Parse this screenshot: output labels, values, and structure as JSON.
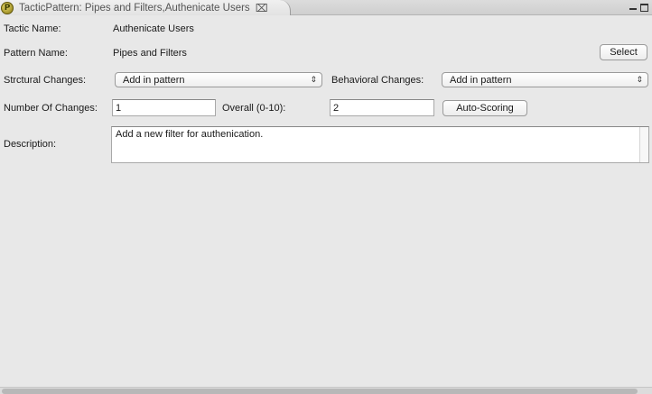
{
  "tab": {
    "title": "TacticPattern: Pipes and Filters,Authenicate Users",
    "icon": "tactic-pattern-icon",
    "icon_glyph": "P",
    "close_glyph": "⌧"
  },
  "form": {
    "tactic_name_label": "Tactic Name:",
    "tactic_name_value": "Authenicate Users",
    "pattern_name_label": "Pattern Name:",
    "pattern_name_value": "Pipes and Filters",
    "select_button_label": "Select",
    "structural_changes_label": "Strctural Changes:",
    "structural_changes_value": "Add in pattern",
    "behavioral_changes_label": "Behavioral Changes:",
    "behavioral_changes_value": "Add in pattern",
    "number_of_changes_label": "Number Of Changes:",
    "number_of_changes_value": "1",
    "overall_label": "Overall (0-10):",
    "overall_value": "2",
    "auto_scoring_label": "Auto-Scoring",
    "description_label": "Description:",
    "description_value": "Add a new filter for authenication."
  },
  "glyphs": {
    "select_arrow": "⇕"
  }
}
